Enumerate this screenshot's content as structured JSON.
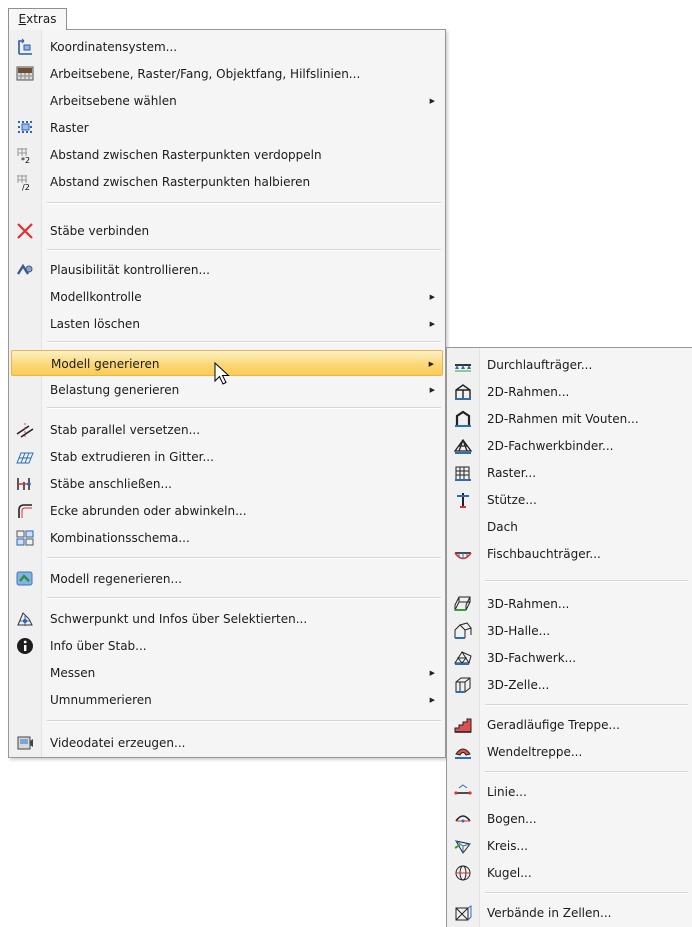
{
  "menubar": {
    "extras_first": "E",
    "extras_rest": "xtras"
  },
  "main_menu": {
    "items": [
      {
        "label": "Koordinatensystem...",
        "icon": "coordinate-system-icon"
      },
      {
        "label": "Arbeitsebene, Raster/Fang, Objektfang, Hilfslinien...",
        "icon": "work-plane-icon"
      },
      {
        "label": "Arbeitsebene wählen",
        "icon": "",
        "submenu": true
      },
      {
        "label": "Raster",
        "icon": "grid-icon"
      },
      {
        "label": "Abstand zwischen Rasterpunkten verdoppeln",
        "icon": "grid-double-icon"
      },
      {
        "label": "Abstand zwischen Rasterpunkten halbieren",
        "icon": "grid-half-icon"
      },
      {
        "label": "Stäbe verbinden",
        "icon": "connect-members-icon"
      },
      {
        "label": "Plausibilität kontrollieren...",
        "icon": "plausibility-check-icon"
      },
      {
        "label": "Modellkontrolle",
        "icon": "",
        "submenu": true
      },
      {
        "label": "Lasten löschen",
        "icon": "",
        "submenu": true
      },
      {
        "label": "Modell generieren",
        "icon": "",
        "submenu": true
      },
      {
        "label": "Belastung generieren",
        "icon": "",
        "submenu": true
      },
      {
        "label": "Stab parallel versetzen...",
        "icon": "offset-member-icon"
      },
      {
        "label": "Stab extrudieren in Gitter...",
        "icon": "extrude-member-icon"
      },
      {
        "label": "Stäbe anschließen...",
        "icon": "join-members-icon"
      },
      {
        "label": "Ecke abrunden oder abwinkeln...",
        "icon": "round-corner-icon"
      },
      {
        "label": "Kombinationsschema...",
        "icon": "combination-scheme-icon"
      },
      {
        "label": "Modell regenerieren...",
        "icon": "regenerate-model-icon"
      },
      {
        "label": "Schwerpunkt und Infos über Selektierten...",
        "icon": "centroid-icon"
      },
      {
        "label": "Info über Stab...",
        "icon": "info-icon"
      },
      {
        "label": "Messen",
        "icon": "",
        "submenu": true
      },
      {
        "label": "Umnummerieren",
        "icon": "",
        "submenu": true
      },
      {
        "label": "Videodatei erzeugen...",
        "icon": "video-file-icon"
      }
    ]
  },
  "sub_menu": {
    "items": [
      {
        "label": "Durchlaufträger...",
        "icon": "continuous-beam-icon"
      },
      {
        "label": "2D-Rahmen...",
        "icon": "frame-2d-icon"
      },
      {
        "label": "2D-Rahmen mit Vouten...",
        "icon": "frame-2d-haunch-icon"
      },
      {
        "label": "2D-Fachwerkbinder...",
        "icon": "truss-2d-icon"
      },
      {
        "label": "Raster...",
        "icon": "grid-generate-icon"
      },
      {
        "label": "Stütze...",
        "icon": "column-icon"
      },
      {
        "label": "Dach",
        "icon": ""
      },
      {
        "label": "Fischbauchträger...",
        "icon": "fish-belly-beam-icon"
      },
      {
        "label": "3D-Rahmen...",
        "icon": "frame-3d-icon"
      },
      {
        "label": "3D-Halle...",
        "icon": "hall-3d-icon"
      },
      {
        "label": "3D-Fachwerk...",
        "icon": "truss-3d-icon"
      },
      {
        "label": "3D-Zelle...",
        "icon": "cell-3d-icon"
      },
      {
        "label": "Geradläufige Treppe...",
        "icon": "straight-stair-icon"
      },
      {
        "label": "Wendeltreppe...",
        "icon": "spiral-stair-icon"
      },
      {
        "label": "Linie...",
        "icon": "line-icon"
      },
      {
        "label": "Bogen...",
        "icon": "arc-icon"
      },
      {
        "label": "Kreis...",
        "icon": "circle-icon"
      },
      {
        "label": "Kugel...",
        "icon": "sphere-icon"
      },
      {
        "label": "Verbände in Zellen...",
        "icon": "bracing-cells-icon"
      }
    ]
  }
}
